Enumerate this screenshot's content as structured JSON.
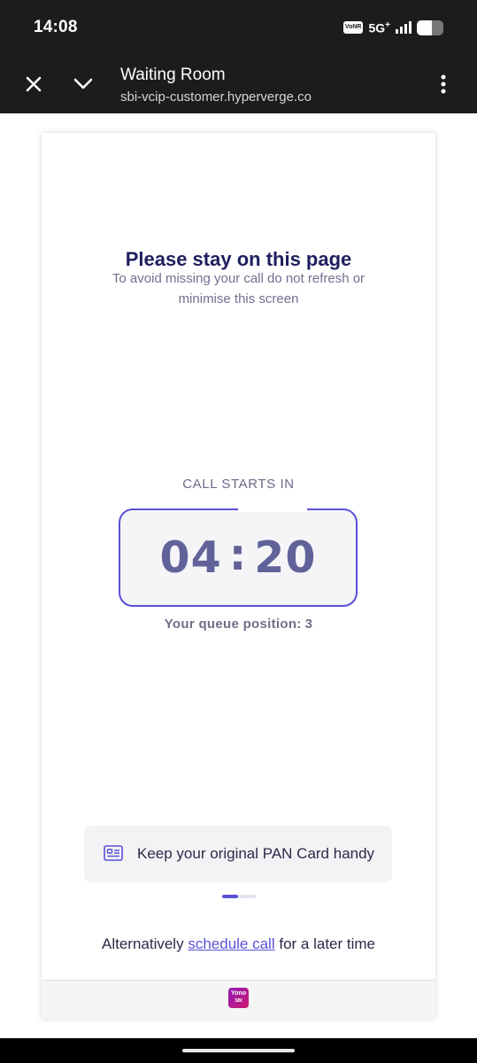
{
  "status_bar": {
    "time": "14:08",
    "vonr": "VoNR",
    "network": "5G",
    "network_plus": "+"
  },
  "browser": {
    "title": "Waiting Room",
    "url": "sbi-vcip-customer.hyperverge.co",
    "icons": [
      "close-icon",
      "chevron-down-icon",
      "more-vert-icon"
    ]
  },
  "page": {
    "heading": "Please stay on this page",
    "subtext": "To avoid missing your call do not refresh or minimise this screen",
    "call_label": "CALL STARTS IN",
    "timer_minutes": "04",
    "timer_colon": ":",
    "timer_seconds": "20",
    "queue_label": "Your queue position:",
    "queue_position": "3",
    "tip_text": "Keep your original PAN Card handy",
    "carousel": {
      "active_index": 0,
      "count": 2
    },
    "alt_prefix": "Alternatively",
    "alt_link": "schedule call",
    "alt_suffix": "for a later time"
  },
  "footer": {
    "logo_text": "Yono",
    "logo_sub": "SBI"
  },
  "colors": {
    "accent": "#5a50d8",
    "heading": "#1e1f5e",
    "timer": "#62629a",
    "chrome_bg": "#1c1c1c"
  }
}
